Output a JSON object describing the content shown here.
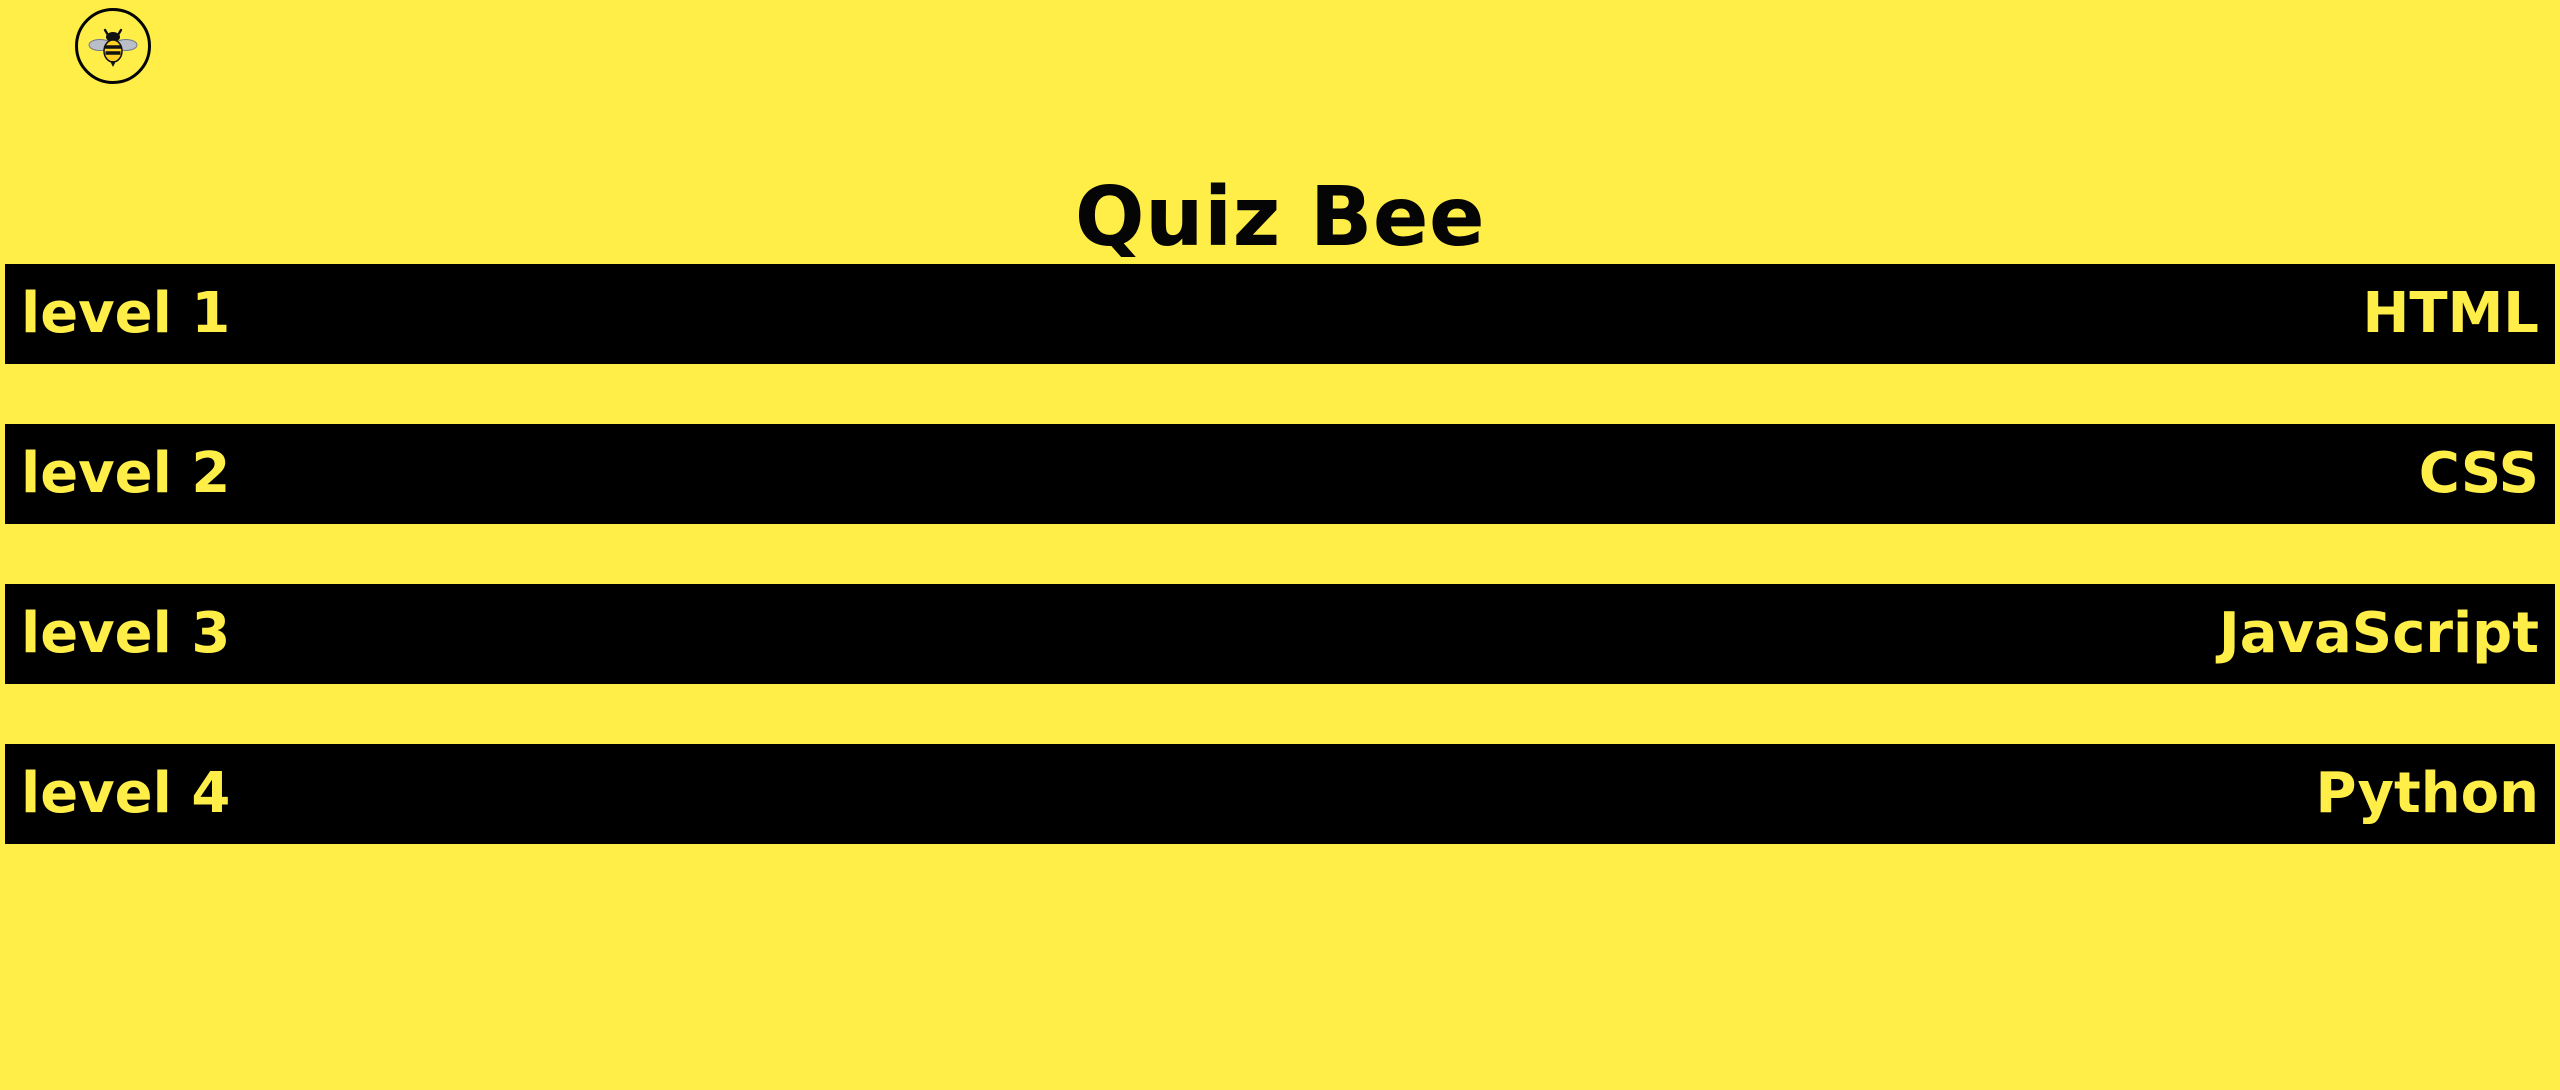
{
  "app": {
    "title": "Quiz Bee",
    "logo_icon": "bee-icon"
  },
  "levels": [
    {
      "label": "level 1",
      "subject": "HTML"
    },
    {
      "label": "level 2",
      "subject": "CSS"
    },
    {
      "label": "level 3",
      "subject": "JavaScript"
    },
    {
      "label": "level 4",
      "subject": "Python"
    }
  ],
  "colors": {
    "background": "#ffee48",
    "text": "#050505",
    "row_background": "#000000",
    "row_text": "#ffee48"
  }
}
